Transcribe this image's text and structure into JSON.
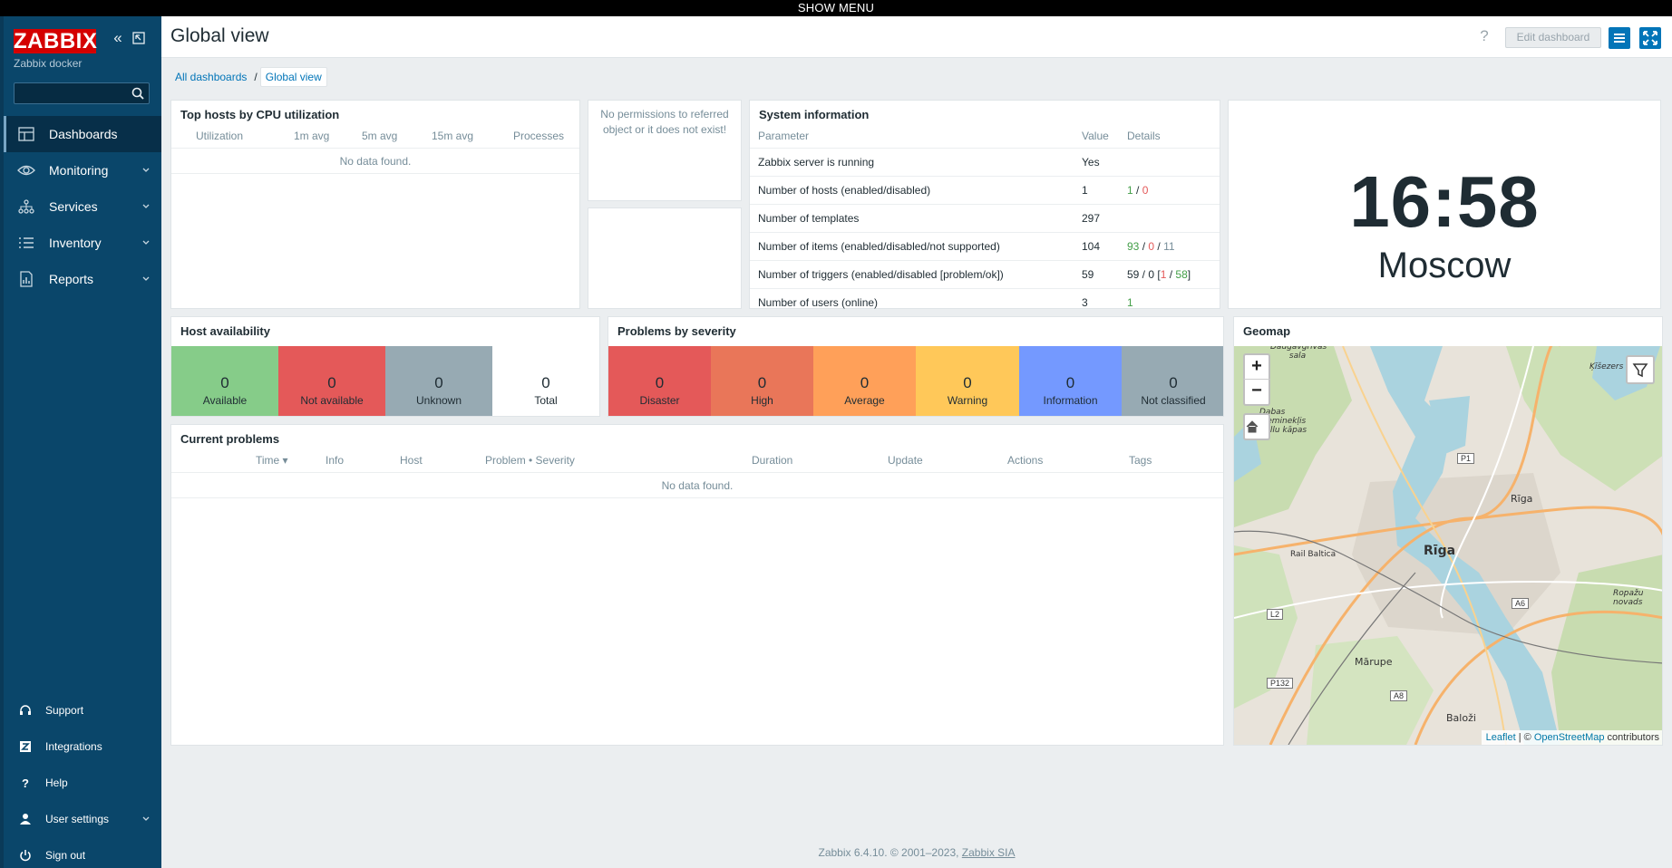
{
  "banner": {
    "label": "SHOW MENU"
  },
  "sidebar": {
    "logo": "ZABBIX",
    "server_name": "Zabbix docker",
    "search": {
      "value": "",
      "placeholder": ""
    },
    "menu": [
      {
        "label": "Dashboards",
        "icon": "dashboards-icon",
        "selected": true
      },
      {
        "label": "Monitoring",
        "icon": "eye-icon"
      },
      {
        "label": "Services",
        "icon": "services-icon"
      },
      {
        "label": "Inventory",
        "icon": "list-icon"
      },
      {
        "label": "Reports",
        "icon": "reports-icon"
      }
    ],
    "bottom": [
      {
        "label": "Support",
        "icon": "headset-icon"
      },
      {
        "label": "Integrations",
        "icon": "integrations-icon"
      },
      {
        "label": "Help",
        "icon": "help-icon"
      },
      {
        "label": "User settings",
        "icon": "user-icon"
      },
      {
        "label": "Sign out",
        "icon": "power-icon"
      }
    ]
  },
  "header": {
    "title": "Global view",
    "help": "?",
    "edit_button": "Edit dashboard"
  },
  "breadcrumb": {
    "all": "All dashboards",
    "sep": "/",
    "current": "Global view"
  },
  "top_hosts": {
    "title": "Top hosts by CPU utilization",
    "columns": [
      "Utilization",
      "1m avg",
      "5m avg",
      "15m avg",
      "Processes"
    ],
    "empty": "No data found."
  },
  "no_permissions": {
    "message": "No permissions to referred object or it does not exist!"
  },
  "system_info": {
    "title": "System information",
    "columns": [
      "Parameter",
      "Value",
      "Details"
    ],
    "rows": [
      {
        "param": "Zabbix server is running",
        "value": "Yes",
        "value_color": "#429e47"
      },
      {
        "param": "Number of hosts (enabled/disabled)",
        "value": "1",
        "d1": "1",
        "d_sep1": " / ",
        "d2": "0"
      },
      {
        "param": "Number of templates",
        "value": "297"
      },
      {
        "param": "Number of items (enabled/disabled/not supported)",
        "value": "104",
        "d1": "93",
        "d_sep1": " / ",
        "d2": "0",
        "d_sep2": " / ",
        "d3": "11"
      },
      {
        "param": "Number of triggers (enabled/disabled [problem/ok])",
        "value": "59",
        "t_a": "59 / 0 [",
        "t_b": "1",
        "t_c": " / ",
        "t_d": "58",
        "t_e": "]"
      },
      {
        "param": "Number of users (online)",
        "value": "3",
        "d1": "1"
      }
    ]
  },
  "clock": {
    "time": "16:58",
    "timezone": "Moscow"
  },
  "host_availability": {
    "title": "Host availability",
    "tiles": [
      {
        "count": "0",
        "label": "Available",
        "color": "#86cc89"
      },
      {
        "count": "0",
        "label": "Not available",
        "color": "#e45959"
      },
      {
        "count": "0",
        "label": "Unknown",
        "color": "#97aab3"
      },
      {
        "count": "0",
        "label": "Total",
        "color": "#ffffff"
      }
    ]
  },
  "problems_by_severity": {
    "title": "Problems by severity",
    "tiles": [
      {
        "count": "0",
        "label": "Disaster",
        "color": "#e45959"
      },
      {
        "count": "0",
        "label": "High",
        "color": "#e97659"
      },
      {
        "count": "0",
        "label": "Average",
        "color": "#ffa059"
      },
      {
        "count": "0",
        "label": "Warning",
        "color": "#ffc859"
      },
      {
        "count": "0",
        "label": "Information",
        "color": "#7499ff"
      },
      {
        "count": "0",
        "label": "Not classified",
        "color": "#97aab3"
      }
    ]
  },
  "geomap": {
    "title": "Geomap",
    "zoom_in": "+",
    "zoom_out": "−",
    "attribution": {
      "leaflet": "Leaflet",
      "sep": " | © ",
      "osm": "OpenStreetMap",
      "suffix": " contributors"
    },
    "labels": [
      "Daugavgrīvas sala",
      "Ķīšezers",
      "Dabas pieminekļis Bullu kāpas",
      "Rīga",
      "Rīga",
      "Rail Baltica",
      "Mārupe",
      "Baloži",
      "Ropažu novads"
    ],
    "shields": [
      "P1",
      "L2",
      "A6",
      "P132",
      "A8"
    ]
  },
  "current_problems": {
    "title": "Current problems",
    "columns": [
      "Time ▾",
      "Info",
      "Host",
      "Problem • Severity",
      "Duration",
      "Update",
      "Actions",
      "Tags"
    ],
    "empty": "No data found."
  },
  "footer": {
    "text": "Zabbix 6.4.10. © 2001–2023, ",
    "link": "Zabbix SIA"
  }
}
